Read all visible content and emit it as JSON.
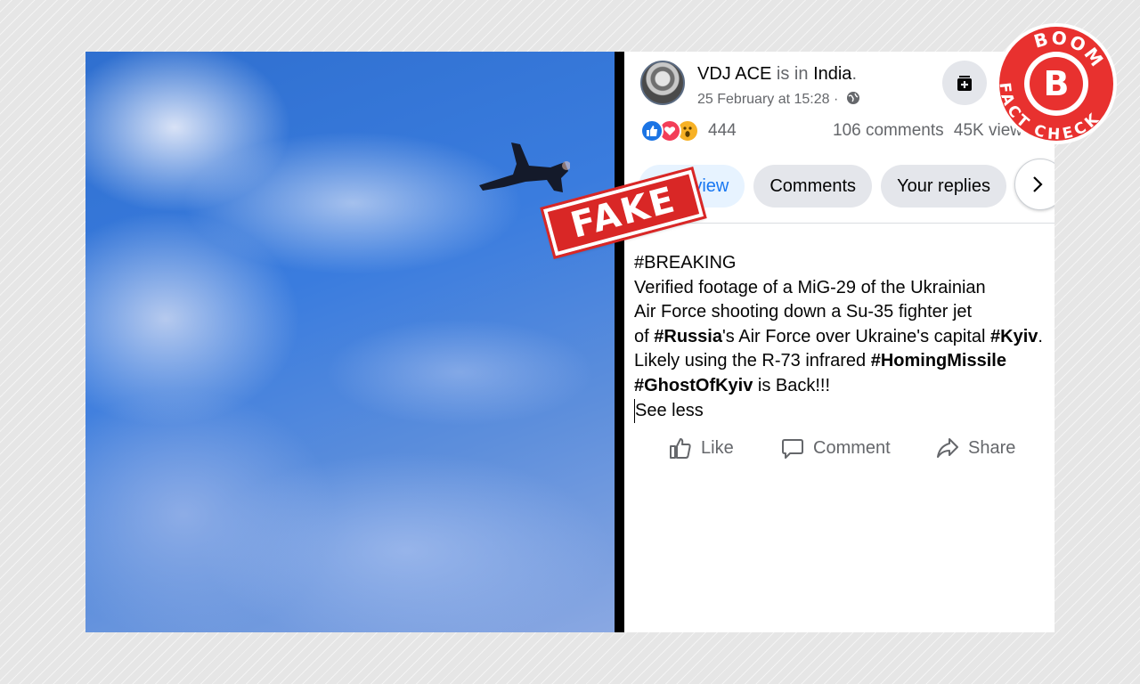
{
  "post": {
    "author": "VDJ ACE",
    "location_prefix": "is in",
    "location": "India",
    "location_suffix": ".",
    "timestamp": "25 February at 15:28",
    "meta_separator": "·",
    "reaction_count": "444",
    "comments": "106 comments",
    "views": "45K views",
    "tabs": [
      {
        "label": "Overview"
      },
      {
        "label": "Comments"
      },
      {
        "label": "Your replies"
      }
    ],
    "body": {
      "line1": "#BREAKING",
      "line2": "Verified footage of a MiG-29 of the Ukrainian",
      "line3": "Air Force shooting down a Su-35 fighter jet",
      "line4_a": "of ",
      "line4_tag1": "#Russia",
      "line4_b": "'s Air Force over Ukraine's capital ",
      "line4_tag2": "#Kyiv",
      "line4_c": ".",
      "line5_a": "Likely using the R-73 infrared ",
      "line5_tag": "#HomingMissile",
      "line6_tag": "#GhostOfKyiv",
      "line6_b": " is Back!!!",
      "see_less": "See less"
    },
    "actions": {
      "like": "Like",
      "comment": "Comment",
      "share": "Share"
    }
  },
  "overlays": {
    "stamp": "FAKE",
    "logo_top": "BOOM",
    "logo_letter": "B",
    "logo_bottom": "FACT CHECK"
  },
  "colors": {
    "facebook_blue": "#1877f2",
    "stamp_red": "#d92726",
    "boom_red": "#e8312f"
  }
}
